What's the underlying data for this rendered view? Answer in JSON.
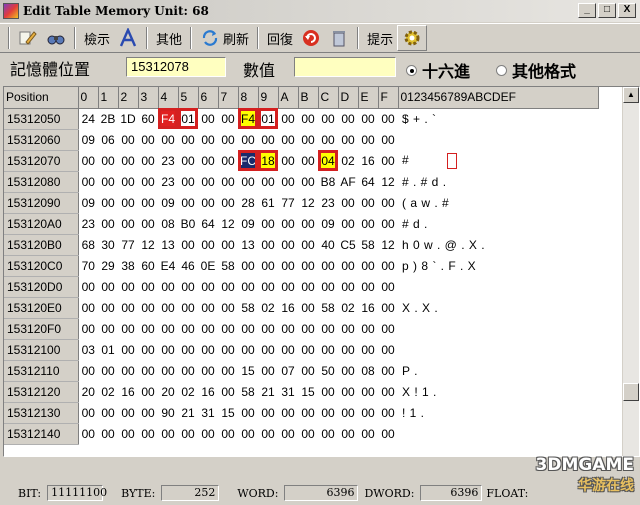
{
  "window": {
    "title": "Edit Table  Memory Unit: 68",
    "minimize": "_",
    "restore": "□",
    "close": "X"
  },
  "toolbar": {
    "show_label": "檢示",
    "other_label": "其他",
    "refresh_label": "刷新",
    "restore_label": "回復",
    "hint_label": "提示"
  },
  "address": {
    "label": "記憶體位置",
    "value": "15312078",
    "value_label": "數值",
    "value_field": "",
    "radio_hex": "十六進",
    "radio_other": "其他格式",
    "hex_selected": true
  },
  "grid": {
    "headers": [
      "Position",
      "0",
      "1",
      "2",
      "3",
      "4",
      "5",
      "6",
      "7",
      "8",
      "9",
      "A",
      "B",
      "C",
      "D",
      "E",
      "F",
      "0123456789ABCDEF"
    ],
    "rows": [
      {
        "pos": "15312050",
        "bytes": [
          "24",
          "2B",
          "1D",
          "60",
          "F4",
          "01",
          "00",
          "00",
          "F4",
          "01",
          "00",
          "00",
          "00",
          "00",
          "00",
          "00"
        ],
        "ascii": "$ + . `"
      },
      {
        "pos": "15312060",
        "bytes": [
          "09",
          "06",
          "00",
          "00",
          "00",
          "00",
          "00",
          "00",
          "00",
          "00",
          "00",
          "00",
          "00",
          "00",
          "00",
          "00"
        ],
        "ascii": ""
      },
      {
        "pos": "15312070",
        "bytes": [
          "00",
          "00",
          "00",
          "00",
          "23",
          "00",
          "00",
          "00",
          "FC",
          "18",
          "00",
          "00",
          "04",
          "02",
          "16",
          "00"
        ],
        "ascii": "#"
      },
      {
        "pos": "15312080",
        "bytes": [
          "00",
          "00",
          "00",
          "00",
          "23",
          "00",
          "00",
          "00",
          "00",
          "00",
          "00",
          "00",
          "B8",
          "AF",
          "64",
          "12"
        ],
        "ascii": "# .  #  d ."
      },
      {
        "pos": "15312090",
        "bytes": [
          "09",
          "00",
          "00",
          "00",
          "09",
          "00",
          "00",
          "00",
          "28",
          "61",
          "77",
          "12",
          "23",
          "00",
          "00",
          "00"
        ],
        "ascii": "( a w . #"
      },
      {
        "pos": "153120A0",
        "bytes": [
          "23",
          "00",
          "00",
          "00",
          "08",
          "B0",
          "64",
          "12",
          "09",
          "00",
          "00",
          "00",
          "09",
          "00",
          "00",
          "00"
        ],
        "ascii": "#  d ."
      },
      {
        "pos": "153120B0",
        "bytes": [
          "68",
          "30",
          "77",
          "12",
          "13",
          "00",
          "00",
          "00",
          "13",
          "00",
          "00",
          "00",
          "40",
          "C5",
          "58",
          "12"
        ],
        "ascii": "h 0 w .  @ . X ."
      },
      {
        "pos": "153120C0",
        "bytes": [
          "70",
          "29",
          "38",
          "60",
          "E4",
          "46",
          "0E",
          "58",
          "00",
          "00",
          "00",
          "00",
          "00",
          "00",
          "00",
          "00"
        ],
        "ascii": "p ) 8 ` . F . X"
      },
      {
        "pos": "153120D0",
        "bytes": [
          "00",
          "00",
          "00",
          "00",
          "00",
          "00",
          "00",
          "00",
          "00",
          "00",
          "00",
          "00",
          "00",
          "00",
          "00",
          "00"
        ],
        "ascii": ""
      },
      {
        "pos": "153120E0",
        "bytes": [
          "00",
          "00",
          "00",
          "00",
          "00",
          "00",
          "00",
          "00",
          "58",
          "02",
          "16",
          "00",
          "58",
          "02",
          "16",
          "00"
        ],
        "ascii": "X .  X ."
      },
      {
        "pos": "153120F0",
        "bytes": [
          "00",
          "00",
          "00",
          "00",
          "00",
          "00",
          "00",
          "00",
          "00",
          "00",
          "00",
          "00",
          "00",
          "00",
          "00",
          "00"
        ],
        "ascii": ""
      },
      {
        "pos": "15312100",
        "bytes": [
          "03",
          "01",
          "00",
          "00",
          "00",
          "00",
          "00",
          "00",
          "00",
          "00",
          "00",
          "00",
          "00",
          "00",
          "00",
          "00"
        ],
        "ascii": ""
      },
      {
        "pos": "15312110",
        "bytes": [
          "00",
          "00",
          "00",
          "00",
          "00",
          "00",
          "00",
          "00",
          "15",
          "00",
          "07",
          "00",
          "50",
          "00",
          "08",
          "00"
        ],
        "ascii": "P ."
      },
      {
        "pos": "15312120",
        "bytes": [
          "20",
          "02",
          "16",
          "00",
          "20",
          "02",
          "16",
          "00",
          "58",
          "21",
          "31",
          "15",
          "00",
          "00",
          "00",
          "00"
        ],
        "ascii": "X ! 1 ."
      },
      {
        "pos": "15312130",
        "bytes": [
          "00",
          "00",
          "00",
          "00",
          "90",
          "21",
          "31",
          "15",
          "00",
          "00",
          "00",
          "00",
          "00",
          "00",
          "00",
          "00"
        ],
        "ascii": "! 1 ."
      },
      {
        "pos": "15312140",
        "bytes": [
          "00",
          "00",
          "00",
          "00",
          "00",
          "00",
          "00",
          "00",
          "00",
          "00",
          "00",
          "00",
          "00",
          "00",
          "00",
          "00"
        ],
        "ascii": ""
      }
    ],
    "highlight_colors": {
      "outline": "#d42020",
      "red": "#e02020",
      "yellow": "#ffff00",
      "navy": "#1a2a6a"
    }
  },
  "status": {
    "bit_label": "BIT:",
    "bit_value": "11111100",
    "byte_label": "BYTE:",
    "byte_value": "252",
    "word_label": "WORD:",
    "word_value": "6396",
    "dword_label": "DWORD:",
    "dword_value": "6396",
    "float_label": "FLOAT:"
  },
  "watermark": {
    "line1": "3DMGAME",
    "line2": "华游在线"
  }
}
